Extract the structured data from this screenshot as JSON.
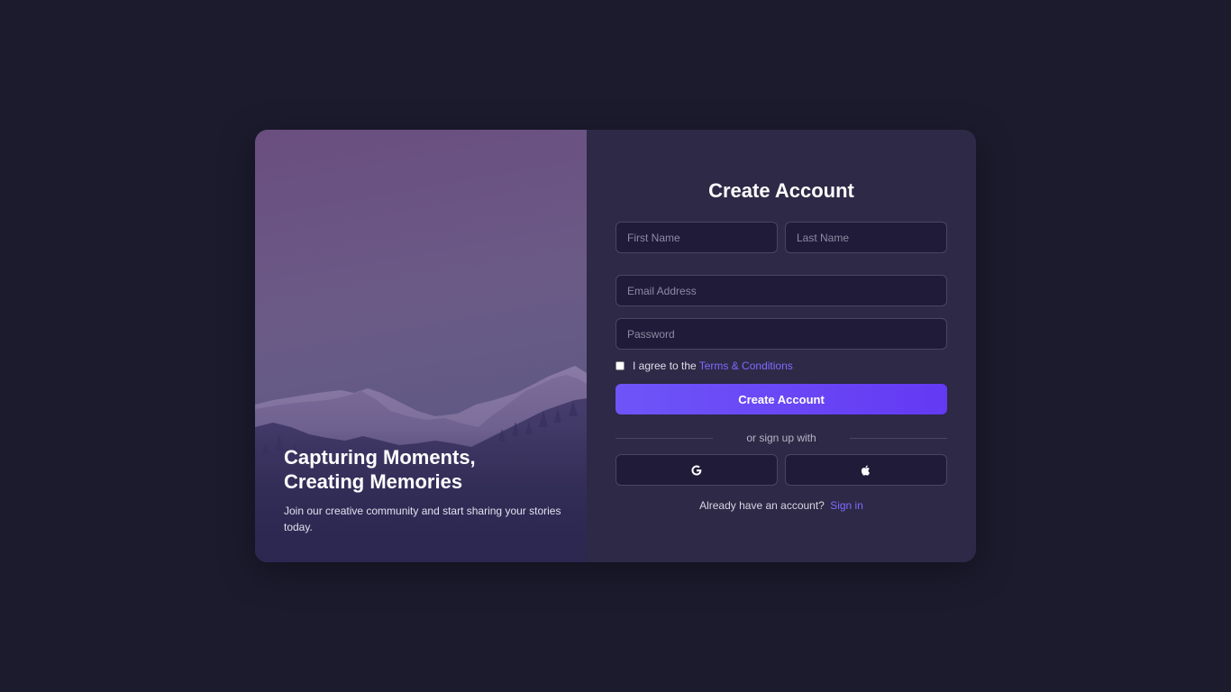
{
  "hero": {
    "title": "Capturing Moments,\nCreating Memories",
    "subtitle": "Join our creative community and start sharing your stories today."
  },
  "form": {
    "title": "Create Account",
    "first_name_placeholder": "First Name",
    "last_name_placeholder": "Last Name",
    "email_placeholder": "Email Address",
    "password_placeholder": "Password",
    "terms_prefix": "I agree to the",
    "terms_link": "Terms & Conditions",
    "submit_label": "Create Account",
    "divider_text": "or sign up with",
    "social": {
      "google_icon": "google-icon",
      "apple_icon": "apple-icon"
    },
    "signin_prefix": "Already have an account?",
    "signin_link": "Sign in"
  },
  "colors": {
    "background": "#1c1b2e",
    "card": "#2d2946",
    "accent": "#6e55f8",
    "link": "#7f6bff"
  }
}
